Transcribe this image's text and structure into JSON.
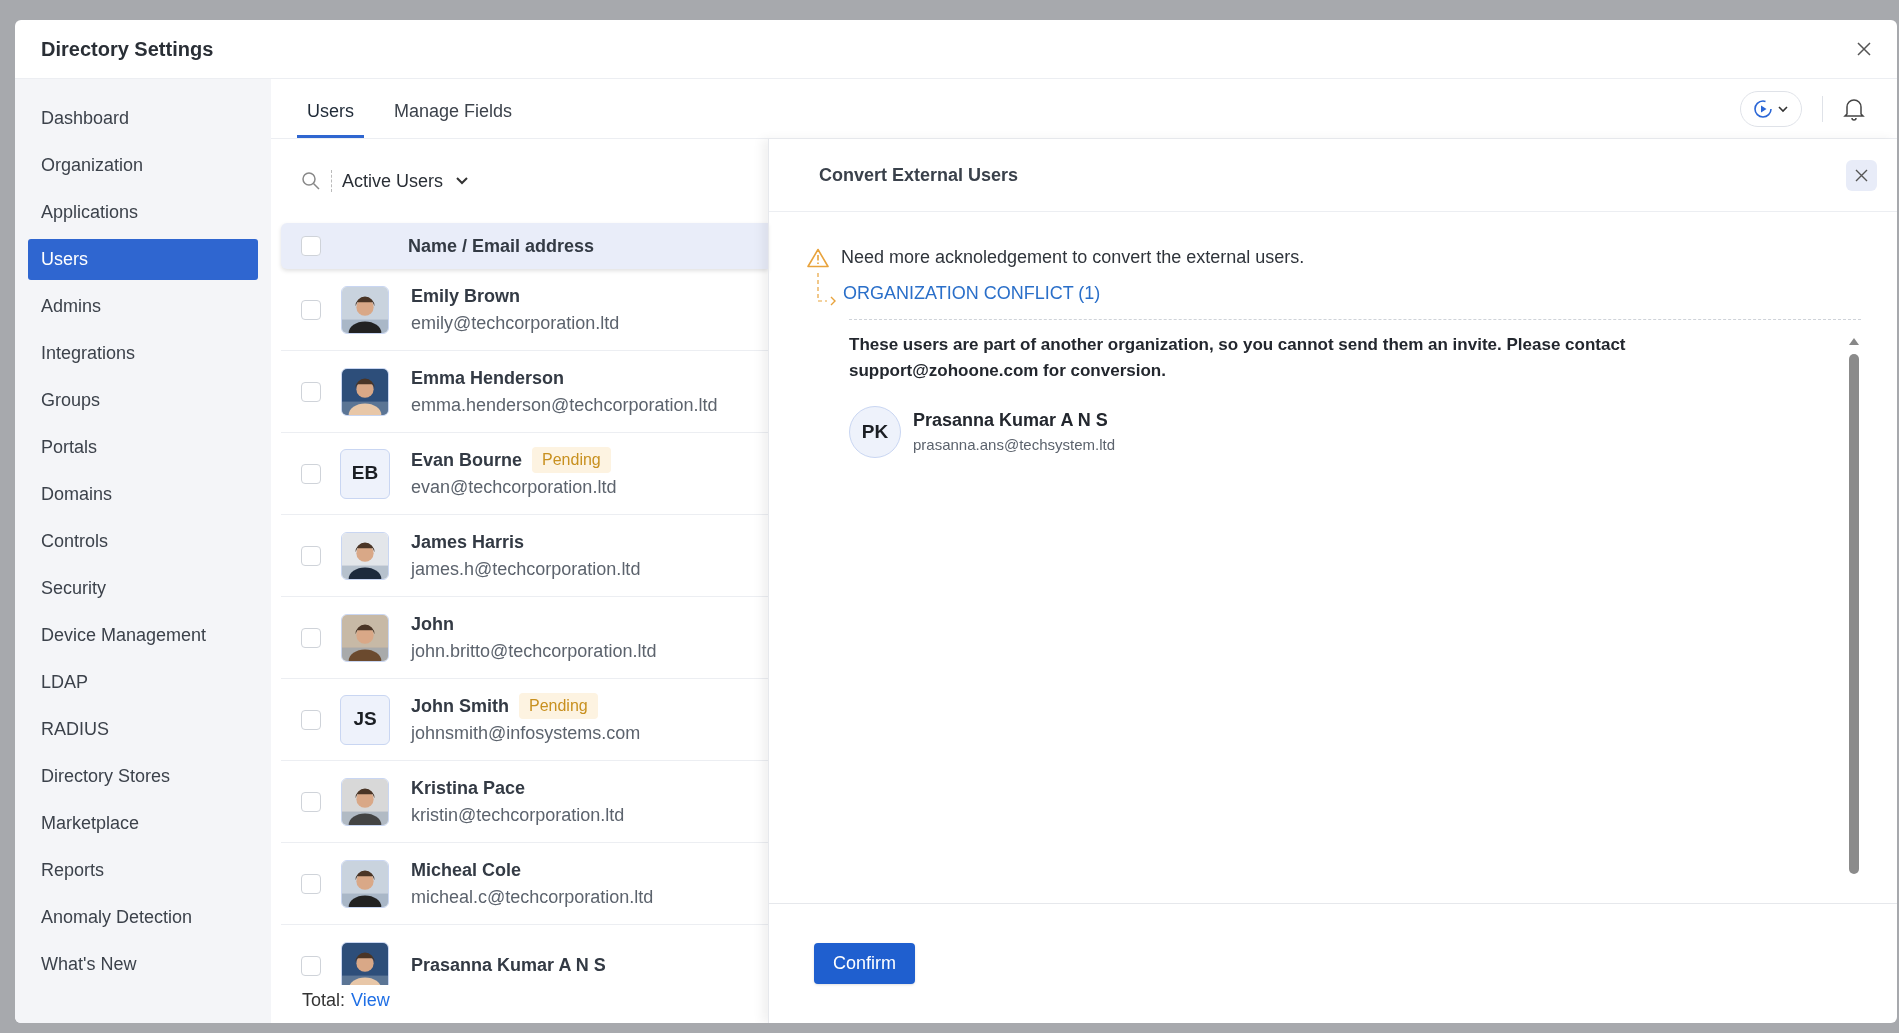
{
  "dialog": {
    "title": "Directory Settings"
  },
  "sidebar": {
    "items": [
      {
        "label": "Dashboard",
        "selected": false
      },
      {
        "label": "Organization",
        "selected": false
      },
      {
        "label": "Applications",
        "selected": false
      },
      {
        "label": "Users",
        "selected": true
      },
      {
        "label": "Admins",
        "selected": false
      },
      {
        "label": "Integrations",
        "selected": false
      },
      {
        "label": "Groups",
        "selected": false
      },
      {
        "label": "Portals",
        "selected": false
      },
      {
        "label": "Domains",
        "selected": false
      },
      {
        "label": "Controls",
        "selected": false
      },
      {
        "label": "Security",
        "selected": false
      },
      {
        "label": "Device Management",
        "selected": false
      },
      {
        "label": "LDAP",
        "selected": false
      },
      {
        "label": "RADIUS",
        "selected": false
      },
      {
        "label": "Directory Stores",
        "selected": false
      },
      {
        "label": "Marketplace",
        "selected": false
      },
      {
        "label": "Reports",
        "selected": false
      },
      {
        "label": "Anomaly Detection",
        "selected": false
      },
      {
        "label": "What's New",
        "selected": false
      }
    ]
  },
  "tabs": [
    {
      "label": "Users",
      "selected": true
    },
    {
      "label": "Manage Fields",
      "selected": false
    }
  ],
  "filter": {
    "label": "Active Users"
  },
  "table": {
    "column": "Name / Email address",
    "header_checked": false,
    "rows": [
      {
        "name": "Emily Brown",
        "email": "emily@techcorporation.ltd",
        "checked": false
      },
      {
        "name": "Emma Henderson",
        "email": "emma.henderson@techcorporation.ltd",
        "checked": false
      },
      {
        "name": "Evan Bourne",
        "badge": "Pending",
        "email": "evan@techcorporation.ltd",
        "avatar": {
          "kind": "initials",
          "text": "EB"
        },
        "checked": false
      },
      {
        "name": "James Harris",
        "email": "james.h@techcorporation.ltd",
        "checked": false
      },
      {
        "name": "John",
        "email": "john.britto@techcorporation.ltd",
        "checked": false
      },
      {
        "name": "John Smith",
        "badge": "Pending",
        "email": "johnsmith@infosystems.com",
        "avatar": {
          "kind": "initials",
          "text": "JS"
        },
        "checked": false
      },
      {
        "name": "Kristina Pace",
        "email": "kristin@techcorporation.ltd",
        "checked": false
      },
      {
        "name": "Micheal Cole",
        "email": "micheal.c@techcorporation.ltd",
        "checked": false
      },
      {
        "name": "Prasanna Kumar A N S",
        "checked": false
      }
    ]
  },
  "total": {
    "label": "Total:",
    "link": "View"
  },
  "panel": {
    "title": "Convert External Users",
    "warning": "Need more acknoledgement to convert the external users.",
    "conflict": "ORGANIZATION CONFLICT (1)",
    "message": "These users are part of another organization, so you cannot send them an invite. Please contact support@zohoone.com for conversion.",
    "users": [
      {
        "initials": "PK",
        "name": "Prasanna Kumar A N S",
        "email": "prasanna.ans@techsystem.ltd"
      }
    ],
    "confirm": "Confirm"
  }
}
